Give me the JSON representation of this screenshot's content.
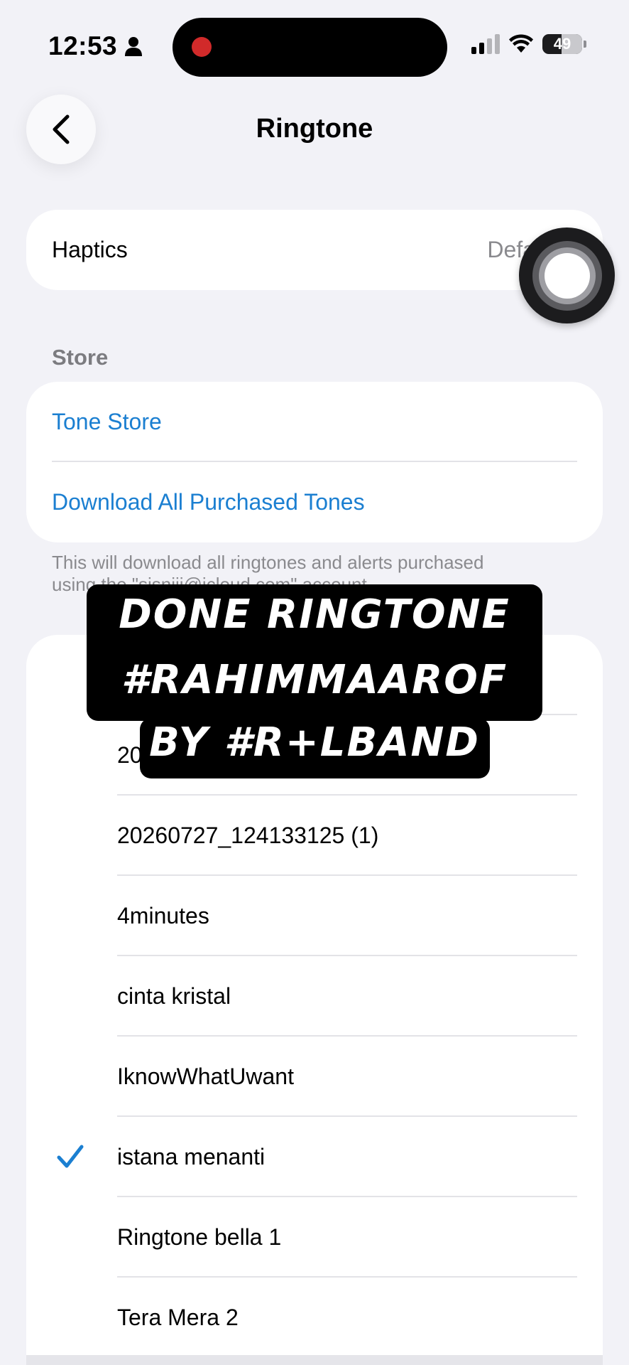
{
  "status": {
    "time": "12:53",
    "battery": "49",
    "battery_level": 0.49
  },
  "nav": {
    "title": "Ringtone",
    "back_icon": "chevron-left-icon"
  },
  "haptics": {
    "label": "Haptics",
    "value": "Defa"
  },
  "store": {
    "header": "Store",
    "tone_store": "Tone Store",
    "download_all": "Download All Purchased Tones",
    "note_line1": "This will download all ringtones and alerts purchased",
    "note_line2": "using the \"sisnjij@icloud.com\" account."
  },
  "tones": [
    {
      "name": "20",
      "selected": false
    },
    {
      "name": "20260727_124133125 (1)",
      "selected": false
    },
    {
      "name": "4minutes",
      "selected": false
    },
    {
      "name": "cinta kristal",
      "selected": false
    },
    {
      "name": "IknowWhatUwant",
      "selected": false
    },
    {
      "name": "istana menanti",
      "selected": true
    },
    {
      "name": "Ringtone bella 1",
      "selected": false
    },
    {
      "name": "Tera Mera 2",
      "selected": false
    }
  ],
  "caption": {
    "line1": "Done RINGTONE",
    "line2": "#RahimMaarof",
    "line3": "by #R+LBAND"
  },
  "colors": {
    "link": "#1b7fd1",
    "checkmark": "#1b7fd1",
    "background": "#f2f2f7",
    "record_dot": "#d12a2a"
  }
}
